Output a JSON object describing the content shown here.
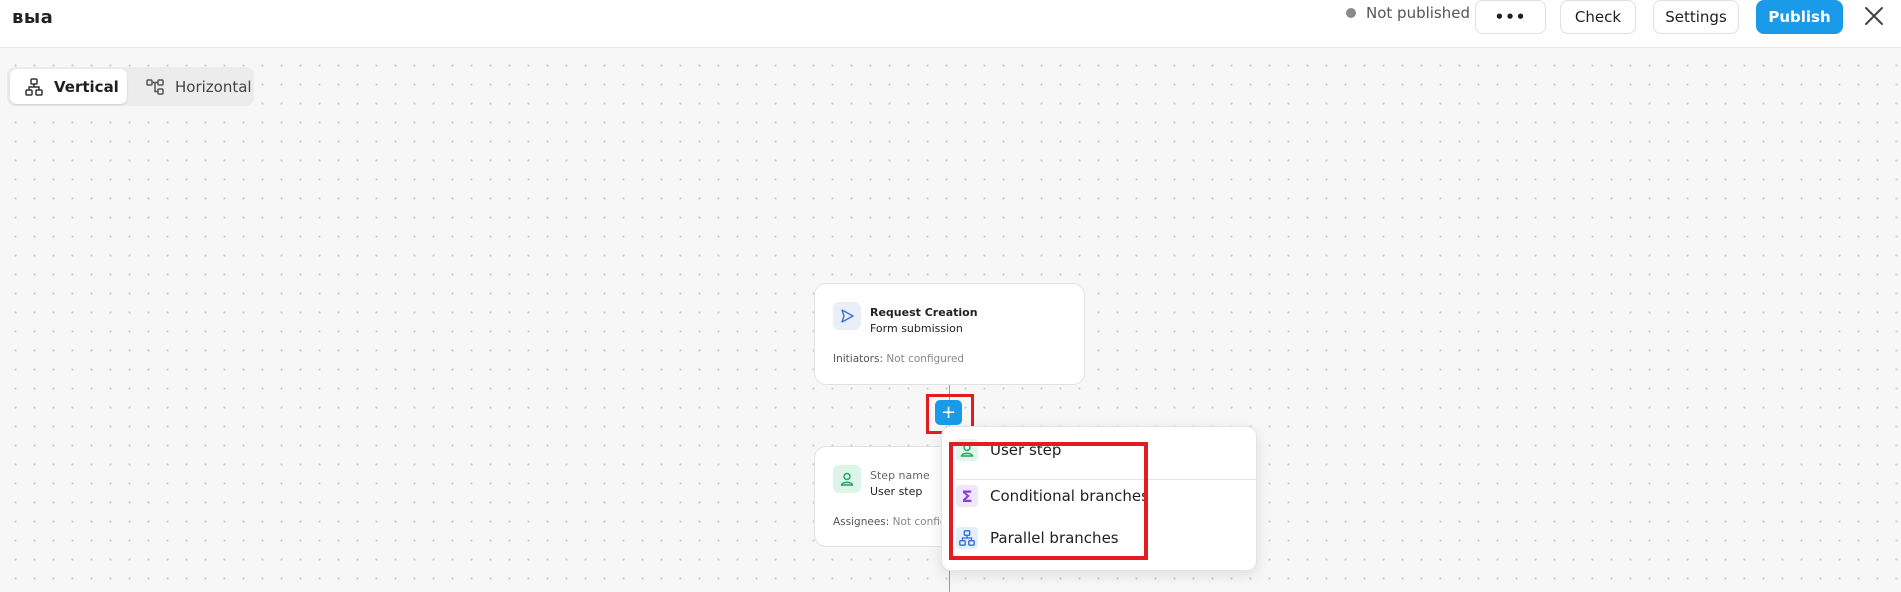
{
  "header": {
    "logo": "выа",
    "status": "Not published",
    "more_label": "•••",
    "check_label": "Check",
    "settings_label": "Settings",
    "publish_label": "Publish",
    "close_icon": "close-icon"
  },
  "layout_toggle": {
    "vertical_label": "Vertical",
    "horizontal_label": "Horizontal",
    "selected": "Vertical"
  },
  "nodes": [
    {
      "title": "Request Creation",
      "subtitle": "Form submission",
      "footer_label": "Initiators:",
      "footer_value": "Not configured",
      "icon": "send-icon"
    },
    {
      "title": "Step name",
      "subtitle": "User step",
      "footer_label": "Assignees:",
      "footer_value": "Not configured",
      "icon": "user-icon"
    }
  ],
  "add_step": {
    "label": "+"
  },
  "add_menu": {
    "items": [
      {
        "label": "User step",
        "icon": "user-icon"
      },
      {
        "label": "Conditional branches",
        "icon": "sigma-icon",
        "glyph": "Σ"
      },
      {
        "label": "Parallel branches",
        "icon": "hierarchy-icon"
      }
    ]
  },
  "colors": {
    "primary": "#1a9be9",
    "highlight": "#e31b23",
    "status_dot": "#8a8a8a"
  }
}
